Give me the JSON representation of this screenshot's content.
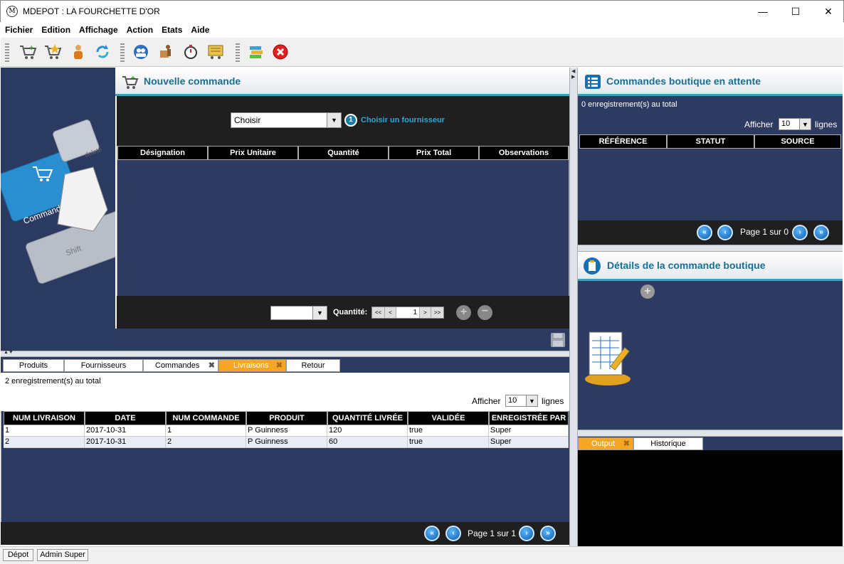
{
  "window": {
    "title": "MDEPOT : LA FOURCHETTE D'OR",
    "app_icon": "M",
    "minimize": "—",
    "maximize": "☐",
    "close": "✕"
  },
  "menu": [
    "Fichier",
    "Edition",
    "Affichage",
    "Action",
    "Etats",
    "Aide"
  ],
  "toolbar_icons": [
    "cart-add-icon",
    "cart-star-icon",
    "person-icon",
    "refresh-icon",
    "users-icon",
    "delivery-icon",
    "stopwatch-icon",
    "cart-list-icon",
    "books-icon",
    "exit-icon"
  ],
  "left_pane": {
    "key1": "Commander",
    "key2": "delete",
    "key3": "Shift"
  },
  "nouvelle": {
    "title": "Nouvelle commande",
    "supplier_combo": "Choisir",
    "step_number": "1",
    "step_label": "Choisir un fournisseur",
    "columns": [
      "Désignation",
      "Prix Unitaire",
      "Quantité",
      "Prix Total",
      "Observations"
    ],
    "quantity_label": "Quantité:",
    "quantity_value": "1",
    "spin": [
      "<<",
      "<",
      ">",
      ">>"
    ]
  },
  "bottom_tabs": {
    "items": [
      "Produits",
      "Fournisseurs",
      "Commandes",
      "Livraisons",
      "Retour"
    ],
    "active": "Livraisons"
  },
  "livraisons": {
    "total_text": "2 enregistrement(s) au total",
    "afficher": "Afficher",
    "lines_value": "10",
    "lignes": "lignes",
    "columns": [
      "NUM LIVRAISON",
      "DATE",
      "NUM COMMANDE",
      "PRODUIT",
      "QUANTITÉ LIVRÉE",
      "VALIDÉE",
      "ENREGISTRÉE PAR"
    ],
    "rows": [
      [
        "1",
        "2017-10-31",
        "1",
        "P Guinness",
        "120",
        "true",
        "Super"
      ],
      [
        "2",
        "2017-10-31",
        "2",
        "P Guinness",
        "60",
        "true",
        "Super"
      ]
    ],
    "page_text": "Page 1 sur 1"
  },
  "attente": {
    "title": "Commandes boutique en attente",
    "total_text": "0 enregistrement(s) au total",
    "afficher": "Afficher",
    "lines_value": "10",
    "lignes": "lignes",
    "columns": [
      "RÉFÉRENCE",
      "STATUT",
      "SOURCE"
    ],
    "page_text": "Page 1 sur 0"
  },
  "details": {
    "title": "Détails de la commande boutique"
  },
  "output_tabs": {
    "items": [
      "Output",
      "Historique"
    ],
    "active": "Output"
  },
  "status": [
    "Dépot",
    "Admin Super"
  ],
  "colors": {
    "accent": "#1a6f92",
    "tab_active": "#f5a623",
    "navy": "#2d3a62"
  }
}
